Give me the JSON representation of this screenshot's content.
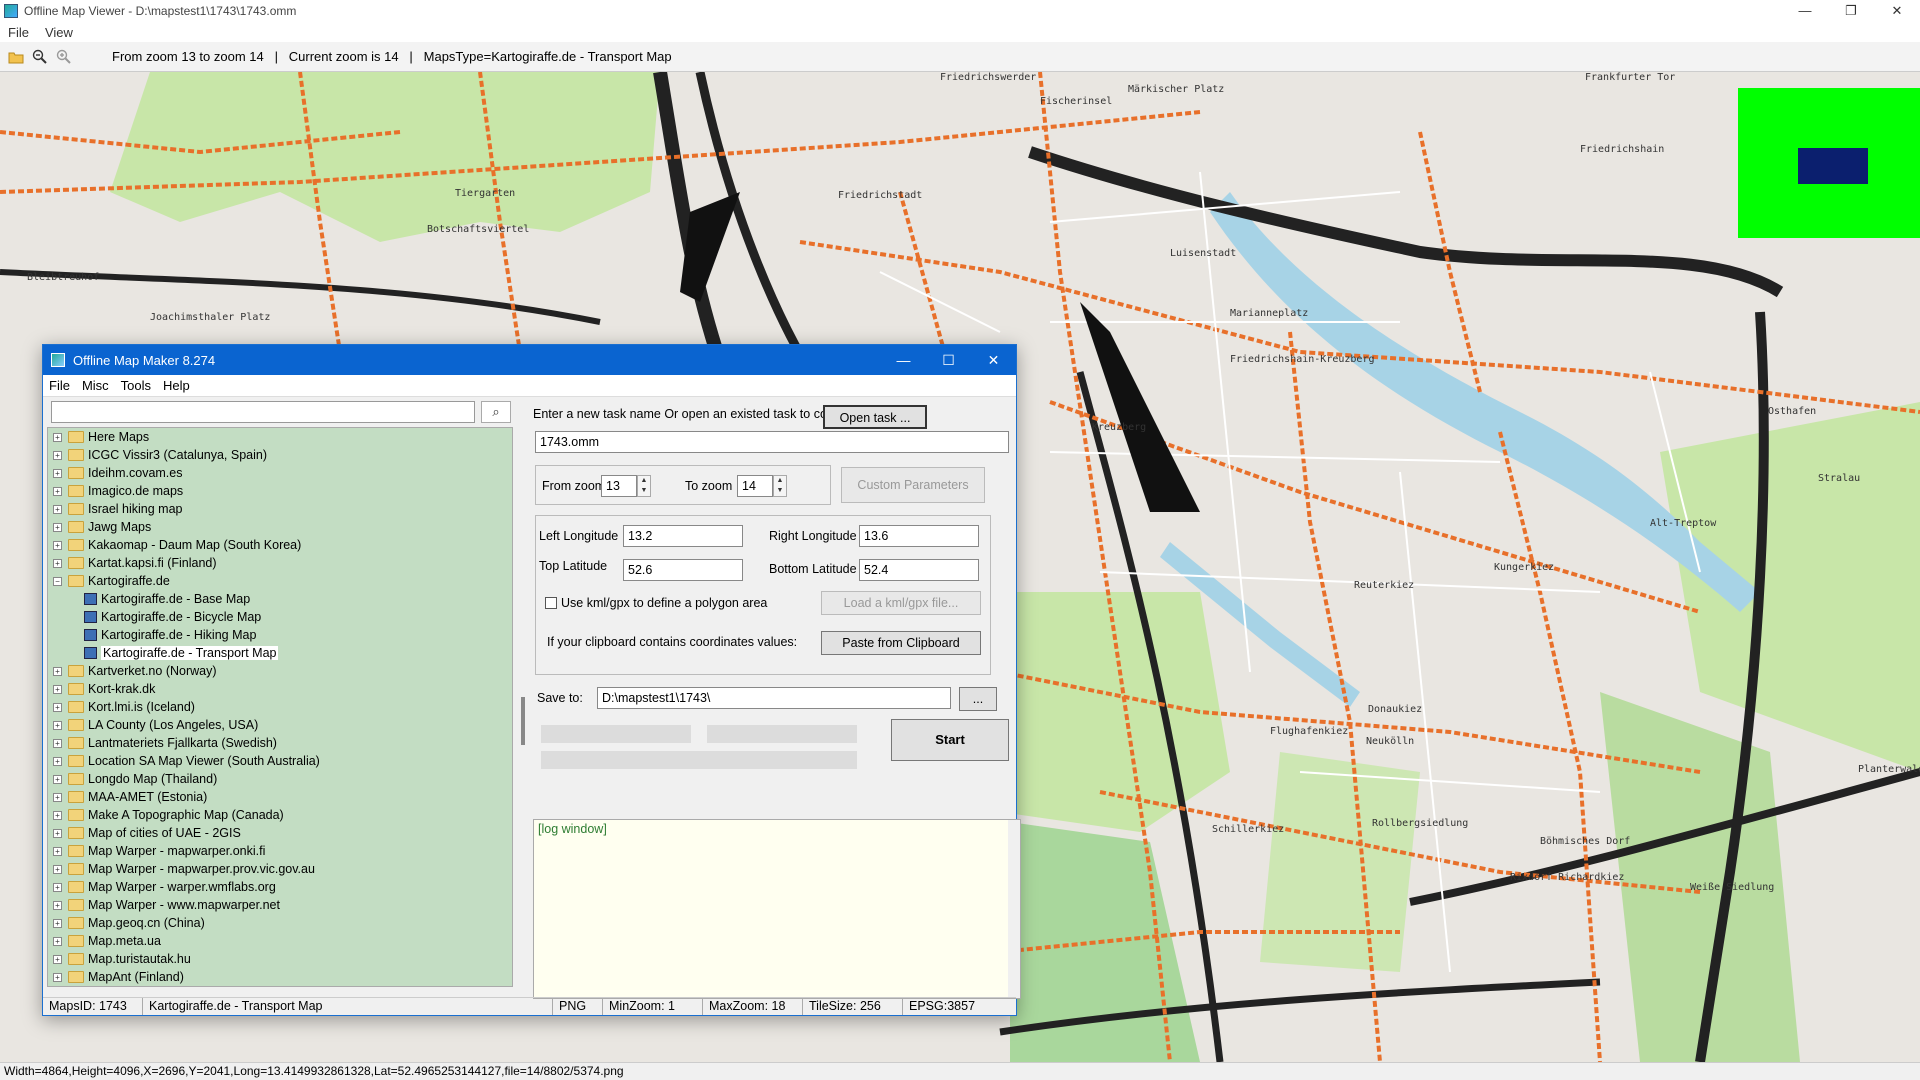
{
  "viewer": {
    "title": "Offline Map Viewer - D:\\mapstest1\\1743\\1743.omm",
    "menu": [
      "File",
      "View"
    ],
    "toolbar_status": "From zoom 13 to zoom 14   |   Current zoom is 14   |   MapsType=Kartogiraffe.de - Transport Map",
    "status_bar": "Width=4864,Height=4096,X=2696,Y=2041,Long=13.4149932861328,Lat=52.4965253144127,file=14/8802/5374.png",
    "window_buttons": [
      "—",
      "❐",
      "✕"
    ]
  },
  "map": {
    "labels": [
      "Friedrichswerder",
      "Fischerinsel",
      "Märkischer Platz",
      "Frankfurter Tor",
      "Friedrichshain",
      "Tiergarten",
      "Friedrichstadt",
      "Botschaftsviertel",
      "Luisenstadt",
      "Bleibtreuhof",
      "Joachimsthaler Platz",
      "Marianneplatz",
      "Friedrichshain-Kreuzberg",
      "Kreuzberg",
      "Osthafen",
      "Stralau",
      "Alt-Treptow",
      "Kungerkiez",
      "Reuterkiez",
      "Donaukiez",
      "Flughafenkiez",
      "Neukölln",
      "Schillerkiez",
      "Rollbergsiedlung",
      "Böhmisches Dorf",
      "Rixdorf Richardkiez",
      "Weiße Siedlung",
      "Planterwald"
    ],
    "colors": {
      "background": "#e9e6e1",
      "park": "#c8e6a8",
      "main_road": "#e8702a",
      "highway": "#222222",
      "water": "#a7d3e6",
      "minimap_bg": "#00ff00",
      "minimap_view": "#0b1f6e"
    }
  },
  "dialog": {
    "title": "Offline Map Maker 8.274",
    "menu": [
      "File",
      "Misc",
      "Tools",
      "Help"
    ],
    "search_placeholder": "",
    "tree": [
      {
        "label": "Here Maps",
        "type": "folder",
        "expander": "+"
      },
      {
        "label": "ICGC Vissir3 (Catalunya, Spain)",
        "type": "folder",
        "expander": "+"
      },
      {
        "label": "Ideihm.covam.es",
        "type": "folder",
        "expander": "+"
      },
      {
        "label": "Imagico.de maps",
        "type": "folder",
        "expander": "+"
      },
      {
        "label": "Israel hiking map",
        "type": "folder",
        "expander": "+"
      },
      {
        "label": "Jawg Maps",
        "type": "folder",
        "expander": "+"
      },
      {
        "label": "Kakaomap - Daum Map (South Korea)",
        "type": "folder",
        "expander": "+"
      },
      {
        "label": "Kartat.kapsi.fi (Finland)",
        "type": "folder",
        "expander": "+"
      },
      {
        "label": "Kartogiraffe.de",
        "type": "folder",
        "expander": "−"
      },
      {
        "label": "Kartogiraffe.de - Base Map",
        "type": "map"
      },
      {
        "label": "Kartogiraffe.de - Bicycle Map",
        "type": "map"
      },
      {
        "label": "Kartogiraffe.de - Hiking Map",
        "type": "map"
      },
      {
        "label": "Kartogiraffe.de - Transport Map",
        "type": "map",
        "selected": true
      },
      {
        "label": "Kartverket.no (Norway)",
        "type": "folder",
        "expander": "+"
      },
      {
        "label": "Kort-krak.dk",
        "type": "folder",
        "expander": "+"
      },
      {
        "label": "Kort.lmi.is (Iceland)",
        "type": "folder",
        "expander": "+"
      },
      {
        "label": "LA County (Los Angeles, USA)",
        "type": "folder",
        "expander": "+"
      },
      {
        "label": "Lantmateriets Fjallkarta (Swedish)",
        "type": "folder",
        "expander": "+"
      },
      {
        "label": "Location SA Map Viewer (South Australia)",
        "type": "folder",
        "expander": "+"
      },
      {
        "label": "Longdo Map (Thailand)",
        "type": "folder",
        "expander": "+"
      },
      {
        "label": "MAA-AMET (Estonia)",
        "type": "folder",
        "expander": "+"
      },
      {
        "label": "Make A Topographic Map (Canada)",
        "type": "folder",
        "expander": "+"
      },
      {
        "label": "Map of cities of UAE - 2GIS",
        "type": "folder",
        "expander": "+"
      },
      {
        "label": "Map Warper - mapwarper.onki.fi",
        "type": "folder",
        "expander": "+"
      },
      {
        "label": "Map Warper - mapwarper.prov.vic.gov.au",
        "type": "folder",
        "expander": "+"
      },
      {
        "label": "Map Warper - warper.wmflabs.org",
        "type": "folder",
        "expander": "+"
      },
      {
        "label": "Map Warper - www.mapwarper.net",
        "type": "folder",
        "expander": "+"
      },
      {
        "label": "Map.geoq.cn (China)",
        "type": "folder",
        "expander": "+"
      },
      {
        "label": "Map.meta.ua",
        "type": "folder",
        "expander": "+"
      },
      {
        "label": "Map.turistautak.hu",
        "type": "folder",
        "expander": "+"
      },
      {
        "label": "MapAnt (Finland)",
        "type": "folder",
        "expander": "+"
      }
    ],
    "task_prompt": "Enter a new task name Or open an existed task to continue:",
    "open_task_button": "Open task ...",
    "task_name": "1743.omm",
    "from_zoom_label": "From zoom",
    "from_zoom": "13",
    "to_zoom_label": "To zoom",
    "to_zoom": "14",
    "custom_params_button": "Custom Parameters",
    "left_lon_label": "Left Longitude",
    "left_lon": "13.2",
    "right_lon_label": "Right Longitude",
    "right_lon": "13.6",
    "top_lat_label": "Top Latitude",
    "top_lat": "52.6",
    "bottom_lat_label": "Bottom Latitude",
    "bottom_lat": "52.4",
    "kml_checkbox_label": "Use kml/gpx to define a polygon area",
    "load_kml_button": "Load a kml/gpx file...",
    "clipboard_label": "If your clipboard contains coordinates values:",
    "paste_button": "Paste from Clipboard",
    "save_to_label": "Save to:",
    "save_to": "D:\\mapstest1\\1743\\",
    "browse_button": "...",
    "start_button": "Start",
    "log_text": "[log window]",
    "status": {
      "maps_id": "MapsID: 1743",
      "map_name": "Kartogiraffe.de - Transport Map",
      "format": "PNG",
      "min_zoom": "MinZoom: 1",
      "max_zoom": "MaxZoom: 18",
      "tile_size": "TileSize: 256",
      "epsg": "EPSG:3857"
    }
  }
}
